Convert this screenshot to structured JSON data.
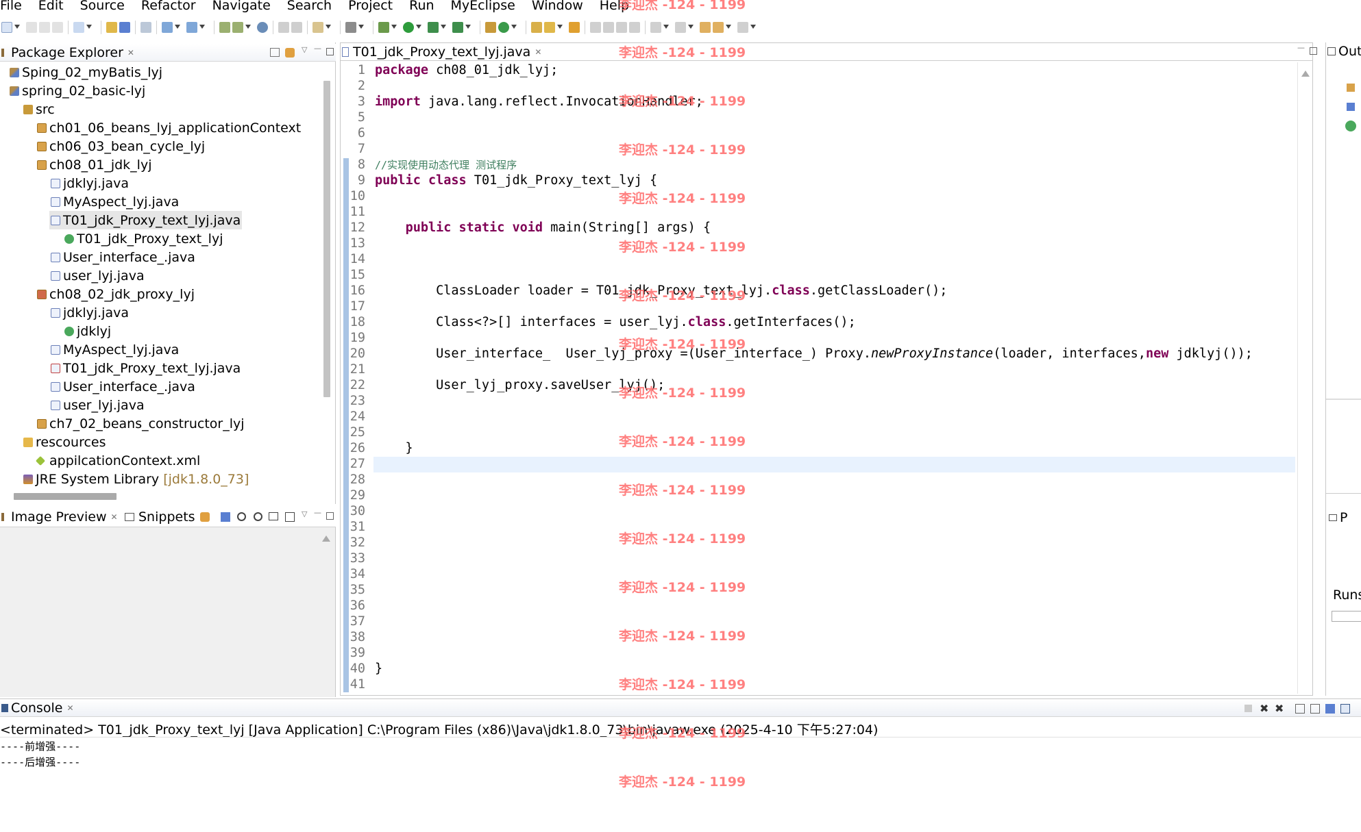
{
  "menu": [
    "File",
    "Edit",
    "Source",
    "Refactor",
    "Navigate",
    "Search",
    "Project",
    "Run",
    "MyEclipse",
    "Window",
    "Help"
  ],
  "package_explorer": {
    "title": "Package Explorer",
    "items": [
      {
        "label": "Sping_02_myBatis_lyj",
        "icon": "project-icon"
      },
      {
        "label": "spring_02_basic-lyj",
        "icon": "project-icon"
      },
      {
        "label": "src",
        "icon": "source-folder-icon"
      },
      {
        "label": "ch01_06_beans_lyj_applicationContext",
        "icon": "package-icon"
      },
      {
        "label": "ch06_03_bean_cycle_lyj",
        "icon": "package-icon"
      },
      {
        "label": "ch08_01_jdk_lyj",
        "icon": "package-icon"
      },
      {
        "label": "jdklyj.java",
        "icon": "java-file-icon"
      },
      {
        "label": "MyAspect_lyj.java",
        "icon": "java-file-icon"
      },
      {
        "label": "T01_jdk_Proxy_text_lyj.java",
        "icon": "java-file-icon"
      },
      {
        "label": "T01_jdk_Proxy_text_lyj",
        "icon": "class-icon"
      },
      {
        "label": "User_interface_.java",
        "icon": "java-file-icon"
      },
      {
        "label": "user_lyj.java",
        "icon": "java-file-icon"
      },
      {
        "label": "ch08_02_jdk_proxy_lyj",
        "icon": "package-icon"
      },
      {
        "label": "jdklyj.java",
        "icon": "java-file-icon"
      },
      {
        "label": "jdklyj",
        "icon": "class-icon"
      },
      {
        "label": "MyAspect_lyj.java",
        "icon": "java-file-icon"
      },
      {
        "label": "T01_jdk_Proxy_text_lyj.java",
        "icon": "java-file-icon"
      },
      {
        "label": "User_interface_.java",
        "icon": "java-file-icon"
      },
      {
        "label": "user_lyj.java",
        "icon": "java-file-icon"
      },
      {
        "label": "ch7_02_beans_constructor_lyj",
        "icon": "package-icon"
      },
      {
        "label": "rescources",
        "icon": "folder-icon"
      },
      {
        "label": "appilcationContext.xml",
        "icon": "xml-file-icon"
      },
      {
        "label": "JRE System Library",
        "icon": "library-icon",
        "suffix": "[jdk1.8.0_73]"
      }
    ]
  },
  "image_preview": {
    "title": "Image Preview",
    "snippets": "Snippets"
  },
  "editor": {
    "tab": "T01_jdk_Proxy_text_lyj.java",
    "lines": [
      {
        "n": "1",
        "code": "package ch08_01_jdk_lyj;"
      },
      {
        "n": "2",
        "code": ""
      },
      {
        "n": "3",
        "code": "import java.lang.reflect.InvocationHandler;"
      },
      {
        "n": "5",
        "code": ""
      },
      {
        "n": "6",
        "code": ""
      },
      {
        "n": "7",
        "code": ""
      },
      {
        "n": "8",
        "code": "//实现使用动态代理 测试程序"
      },
      {
        "n": "9",
        "code": "public class T01_jdk_Proxy_text_lyj {"
      },
      {
        "n": "10",
        "code": ""
      },
      {
        "n": "11",
        "code": ""
      },
      {
        "n": "12",
        "code": "    public static void main(String[] args) {"
      },
      {
        "n": "13",
        "code": ""
      },
      {
        "n": "14",
        "code": ""
      },
      {
        "n": "15",
        "code": ""
      },
      {
        "n": "16",
        "code": "        ClassLoader loader = T01_jdk_Proxy_text_lyj.class.getClassLoader();"
      },
      {
        "n": "17",
        "code": ""
      },
      {
        "n": "18",
        "code": "        Class<?>[] interfaces = user_lyj.class.getInterfaces();"
      },
      {
        "n": "19",
        "code": ""
      },
      {
        "n": "20",
        "code": "        User_interface_  User_lyj_proxy =(User_interface_) Proxy.newProxyInstance(loader, interfaces,new jdklyj());"
      },
      {
        "n": "21",
        "code": ""
      },
      {
        "n": "22",
        "code": "        User_lyj_proxy.saveUser_lyj();"
      },
      {
        "n": "23",
        "code": ""
      },
      {
        "n": "24",
        "code": ""
      },
      {
        "n": "25",
        "code": ""
      },
      {
        "n": "26",
        "code": "    }"
      },
      {
        "n": "27",
        "code": ""
      },
      {
        "n": "28",
        "code": ""
      },
      {
        "n": "29",
        "code": ""
      },
      {
        "n": "30",
        "code": ""
      },
      {
        "n": "31",
        "code": ""
      },
      {
        "n": "32",
        "code": ""
      },
      {
        "n": "33",
        "code": ""
      },
      {
        "n": "34",
        "code": ""
      },
      {
        "n": "35",
        "code": ""
      },
      {
        "n": "36",
        "code": ""
      },
      {
        "n": "37",
        "code": ""
      },
      {
        "n": "38",
        "code": ""
      },
      {
        "n": "39",
        "code": ""
      },
      {
        "n": "40",
        "code": "}"
      },
      {
        "n": "41",
        "code": ""
      }
    ]
  },
  "outline": {
    "title": "Out",
    "p_tab": "P",
    "runs": "Runs"
  },
  "console": {
    "title": "Console",
    "status": "<terminated> T01_jdk_Proxy_text_lyj [Java Application] C:\\Program Files (x86)\\Java\\jdk1.8.0_73\\bin\\javaw.exe (2025-4-10 下午5:27:04)",
    "output": [
      "----前增强----",
      "----后增强----"
    ]
  },
  "watermark": "李迎杰 -124 - 1199"
}
